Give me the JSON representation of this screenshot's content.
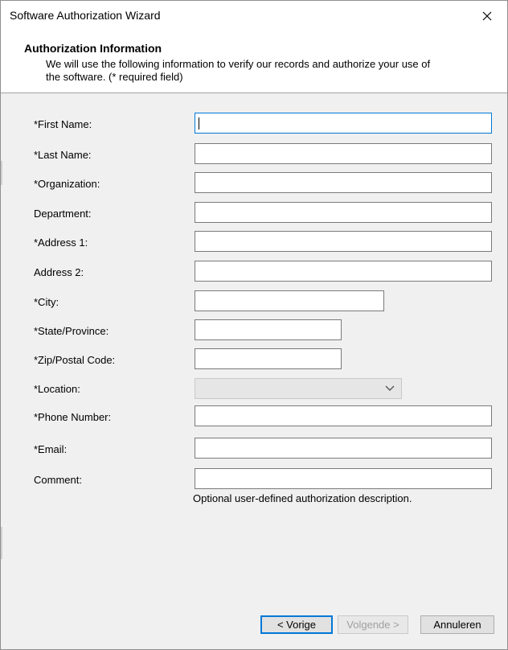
{
  "window": {
    "title": "Software Authorization Wizard"
  },
  "header": {
    "title": "Authorization Information",
    "description_line1": "We will use the following information to verify our records and authorize your use of",
    "description_line2": "the software. (* required field)"
  },
  "form": {
    "first_name": {
      "label": "*First Name:",
      "value": ""
    },
    "last_name": {
      "label": "*Last Name:",
      "value": ""
    },
    "organization": {
      "label": "*Organization:",
      "value": ""
    },
    "department": {
      "label": "Department:",
      "value": ""
    },
    "address1": {
      "label": "*Address 1:",
      "value": ""
    },
    "address2": {
      "label": "Address 2:",
      "value": ""
    },
    "city": {
      "label": "*City:",
      "value": ""
    },
    "state": {
      "label": "*State/Province:",
      "value": ""
    },
    "zip": {
      "label": "*Zip/Postal Code:",
      "value": ""
    },
    "location": {
      "label": "*Location:",
      "value": ""
    },
    "phone": {
      "label": "*Phone Number:",
      "value": ""
    },
    "email": {
      "label": "*Email:",
      "value": ""
    },
    "comment": {
      "label": "Comment:",
      "value": ""
    },
    "comment_hint": "Optional user-defined authorization description."
  },
  "buttons": {
    "back": "< Vorige",
    "next": "Volgende >",
    "cancel": "Annuleren"
  },
  "icons": {
    "close": "close-icon",
    "dropdown": "chevron-down-icon"
  }
}
